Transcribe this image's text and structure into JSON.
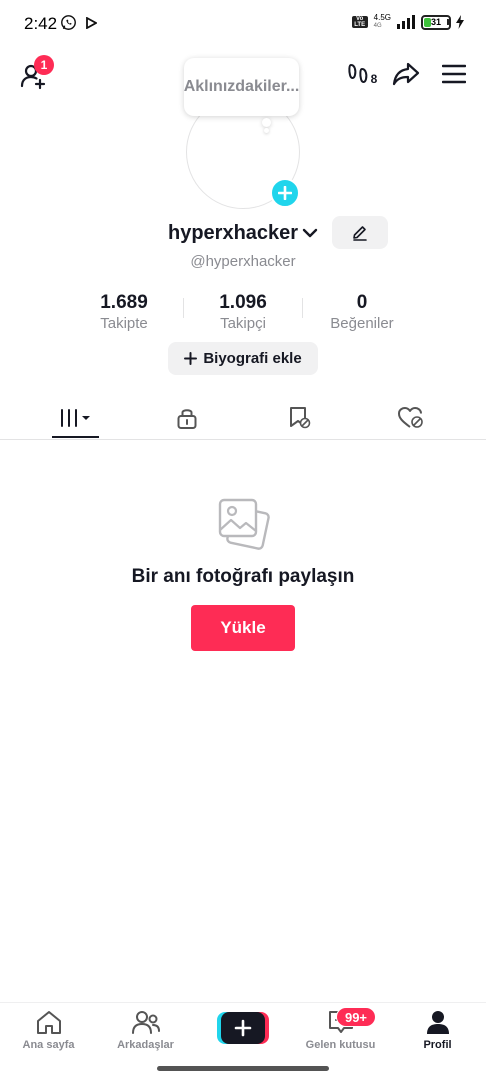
{
  "status_bar": {
    "time": "2:42",
    "network_top": "4.5G",
    "network_sub": "4G",
    "volte": "Vo LTE",
    "battery": "31"
  },
  "header": {
    "add_friend_badge": "1",
    "thought_bubble": "Aklınızdakiler...",
    "stories_count": "8"
  },
  "profile": {
    "username": "hyperxhacker",
    "handle": "@hyperxhacker",
    "stats": [
      {
        "value": "1.689",
        "label": "Takipte"
      },
      {
        "value": "1.096",
        "label": "Takipçi"
      },
      {
        "value": "0",
        "label": "Beğeniler"
      }
    ],
    "bio_button": "Biyografi ekle"
  },
  "empty_state": {
    "message": "Bir anı fotoğrafı paylaşın",
    "upload_button": "Yükle"
  },
  "bottom_nav": {
    "items": [
      {
        "label": "Ana sayfa",
        "icon": "home-icon"
      },
      {
        "label": "Arkadaşlar",
        "icon": "friends-icon"
      },
      {
        "label": "",
        "icon": "create-icon"
      },
      {
        "label": "Gelen kutusu",
        "icon": "inbox-icon",
        "badge": "99+"
      },
      {
        "label": "Profil",
        "icon": "profile-icon"
      }
    ]
  },
  "colors": {
    "accent": "#fe2c55",
    "cyan": "#20d5ec",
    "text": "#161823",
    "muted": "#8a8b91"
  }
}
